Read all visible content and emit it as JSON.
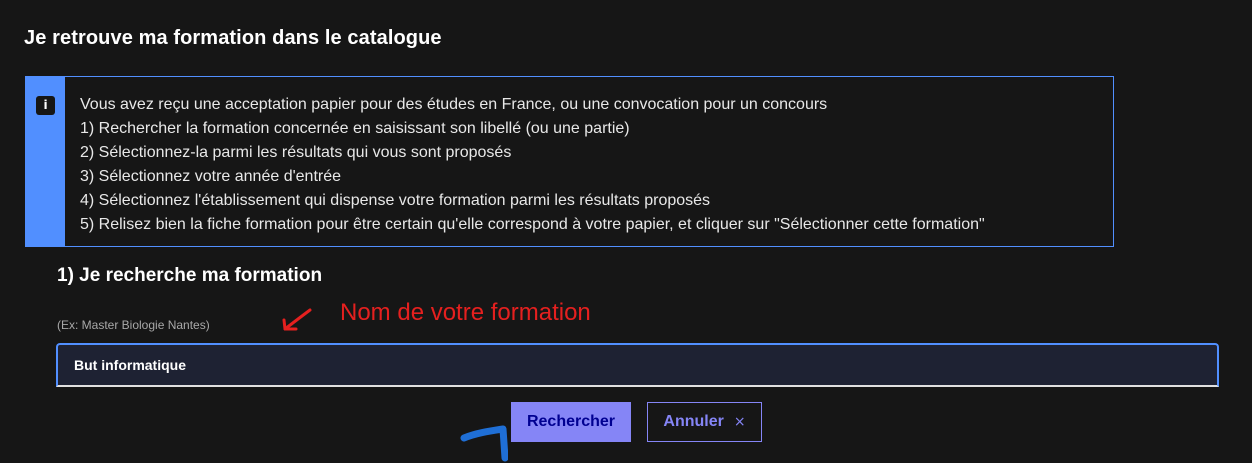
{
  "page": {
    "title": "Je retrouve ma formation dans le catalogue"
  },
  "info": {
    "icon": "info-icon",
    "icon_glyph": "i",
    "lines": [
      "Vous avez reçu une acceptation papier pour des études en France, ou une convocation pour un concours",
      "1) Rechercher la formation concernée en saisissant son libellé (ou une partie)",
      "2) Sélectionnez-la parmi les résultats qui vous sont proposés",
      "3) Sélectionnez votre année d'entrée",
      "4) Sélectionnez l'établissement qui dispense votre formation parmi les résultats proposés",
      "5) Relisez bien la fiche formation pour être certain qu'elle correspond à votre papier, et cliquer sur \"Sélectionner cette formation\""
    ]
  },
  "search": {
    "section_title": "1) Je recherche ma formation",
    "hint": "(Ex: Master Biologie Nantes)",
    "value": "But informatique",
    "annotation": "Nom de votre formation"
  },
  "buttons": {
    "search_label": "Rechercher",
    "cancel_label": "Annuler",
    "cancel_icon": "×"
  },
  "colors": {
    "accent_blue": "#518fff",
    "primary_button": "#8585f6",
    "annotation_red": "#e5201f",
    "annotation_blue": "#1f6fd6"
  }
}
